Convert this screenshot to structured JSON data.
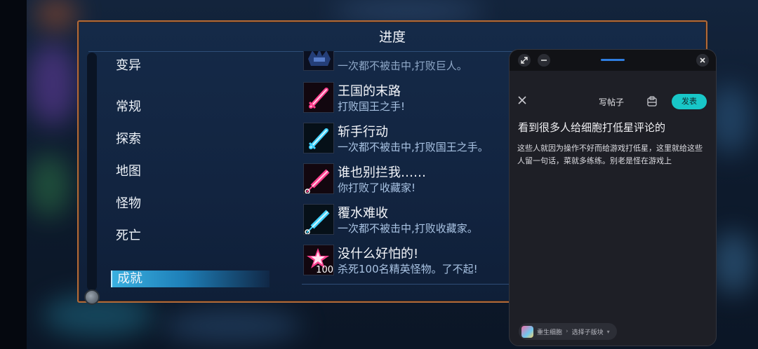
{
  "window": {
    "title": "进度"
  },
  "categories": [
    {
      "label": "变异",
      "selected": false
    },
    {
      "label": "常规",
      "selected": false
    },
    {
      "label": "探索",
      "selected": false
    },
    {
      "label": "地图",
      "selected": false
    },
    {
      "label": "怪物",
      "selected": false
    },
    {
      "label": "死亡",
      "selected": false
    },
    {
      "label": "成就",
      "selected": true
    }
  ],
  "achievements": [
    {
      "name": "",
      "desc": "一次都不被击中,打败巨人。",
      "icon": "boss-icon"
    },
    {
      "name": "王国的末路",
      "desc": "打败国王之手!",
      "icon": "pink-sword-icon"
    },
    {
      "name": "斩手行动",
      "desc": "一次都不被击中,打败国王之手。",
      "icon": "blue-sword-icon"
    },
    {
      "name": "谁也别拦我……",
      "desc": "你打败了收藏家!",
      "icon": "pink-syringe-icon"
    },
    {
      "name": "覆水难收",
      "desc": "一次都不被击中,打败收藏家。",
      "icon": "blue-syringe-icon"
    },
    {
      "name": "没什么好怕的!",
      "desc": "杀死100名精英怪物。了不起!",
      "icon": "star-icon",
      "badge": "100"
    }
  ],
  "post_panel": {
    "title": "写帖子",
    "publish_label": "发表",
    "heading": "看到很多人给细胞打低星评论的",
    "body": "这些人就因为操作不好而给游戏打低星，这里就给这些人留一句话，菜就多练练。别老是怪在游戏上",
    "forum": "重生细胞",
    "section_placeholder": "选择子版块"
  },
  "colors": {
    "accent_border": "#b06a3a",
    "selected_category": "#3ab0e0",
    "publish_button": "#18c7c8",
    "achievement_pink": "#ff3f8e",
    "achievement_blue": "#3fd2ff"
  }
}
